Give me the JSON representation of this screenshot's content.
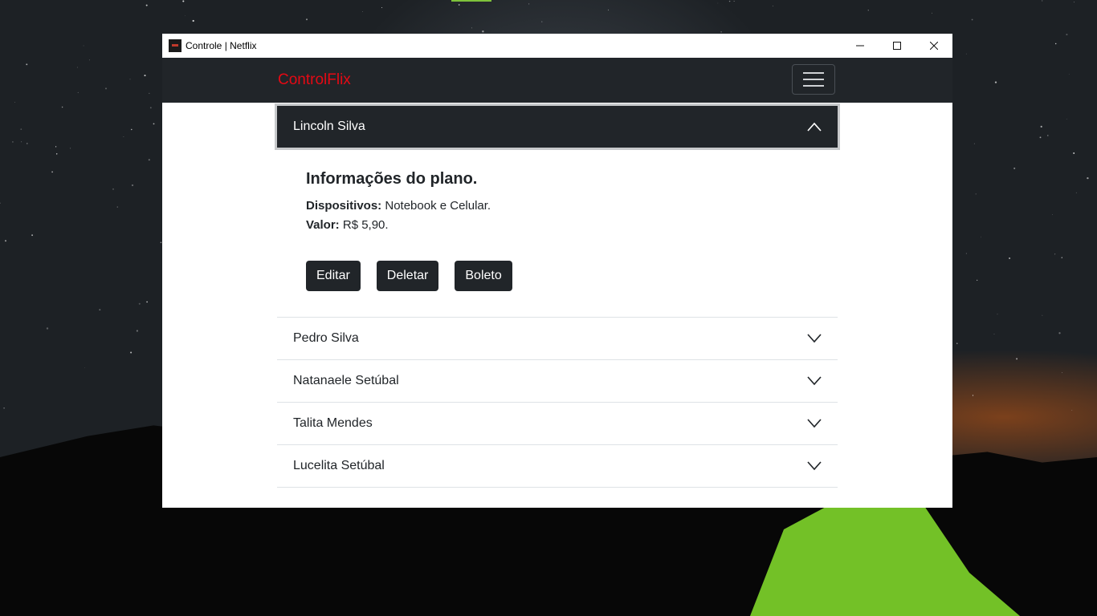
{
  "window": {
    "title": "Controle | Netflix"
  },
  "navbar": {
    "brand": "ControlFlix"
  },
  "accordion": {
    "open_item": {
      "name": "Lincoln Silva",
      "heading": "Informações do plano.",
      "devices_label": "Dispositivos:",
      "devices_value": " Notebook e Celular.",
      "price_label": "Valor:",
      "price_value": " R$ 5,90.",
      "buttons": [
        "Editar",
        "Deletar",
        "Boleto"
      ]
    },
    "items": [
      {
        "name": "Pedro Silva"
      },
      {
        "name": "Natanaele Setúbal"
      },
      {
        "name": "Talita Mendes"
      },
      {
        "name": "Lucelita Setúbal"
      }
    ]
  },
  "colors": {
    "brand": "#e50914",
    "navbar": "#212529",
    "button": "#212529"
  }
}
